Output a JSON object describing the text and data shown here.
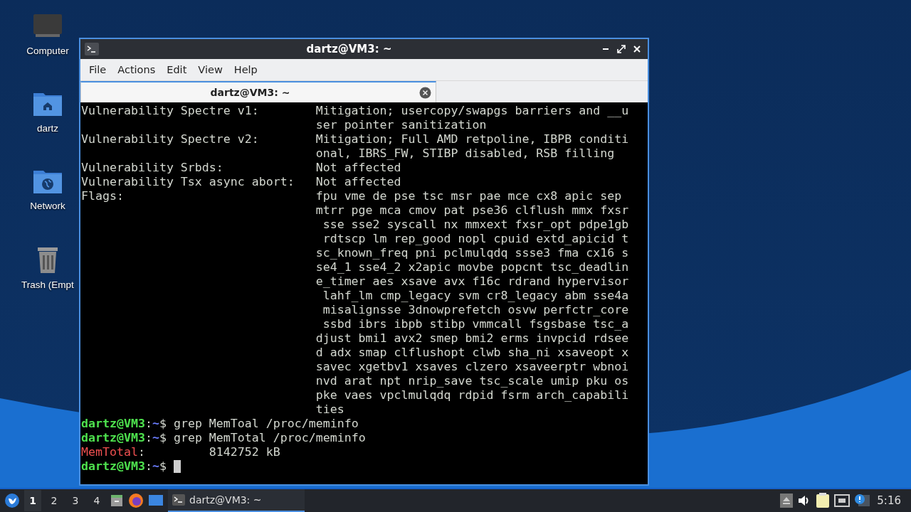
{
  "desktop_icons": [
    {
      "label": "Computer",
      "kind": "computer"
    },
    {
      "label": "dartz",
      "kind": "home"
    },
    {
      "label": "Network",
      "kind": "network"
    },
    {
      "label": "Trash (Empt",
      "kind": "trash"
    }
  ],
  "window": {
    "title": "dartz@VM3: ~",
    "menu": [
      "File",
      "Actions",
      "Edit",
      "View",
      "Help"
    ],
    "tabs": [
      {
        "label": "dartz@VM3: ~",
        "selected": true
      }
    ],
    "terminal": [
      {
        "kind": "field",
        "label": "Vulnerability Spectre v1:",
        "lines": [
          "Mitigation; usercopy/swapgs barriers and __u",
          "ser pointer sanitization"
        ]
      },
      {
        "kind": "field",
        "label": "Vulnerability Spectre v2:",
        "lines": [
          "Mitigation; Full AMD retpoline, IBPB conditi",
          "onal, IBRS_FW, STIBP disabled, RSB filling"
        ]
      },
      {
        "kind": "field",
        "label": "Vulnerability Srbds:",
        "lines": [
          "Not affected"
        ]
      },
      {
        "kind": "field",
        "label": "Vulnerability Tsx async abort:",
        "lines": [
          "Not affected"
        ]
      },
      {
        "kind": "field",
        "label": "Flags:",
        "lines": [
          "fpu vme de pse tsc msr pae mce cx8 apic sep",
          "mtrr pge mca cmov pat pse36 clflush mmx fxsr",
          " sse sse2 syscall nx mmxext fxsr_opt pdpe1gb",
          " rdtscp lm rep_good nopl cpuid extd_apicid t",
          "sc_known_freq pni pclmulqdq ssse3 fma cx16 s",
          "se4_1 sse4_2 x2apic movbe popcnt tsc_deadlin",
          "e_timer aes xsave avx f16c rdrand hypervisor",
          " lahf_lm cmp_legacy svm cr8_legacy abm sse4a",
          " misalignsse 3dnowprefetch osvw perfctr_core",
          " ssbd ibrs ibpb stibp vmmcall fsgsbase tsc_a",
          "djust bmi1 avx2 smep bmi2 erms invpcid rdsee",
          "d adx smap clflushopt clwb sha_ni xsaveopt x",
          "savec xgetbv1 xsaves clzero xsaveerptr wbnoi",
          "nvd arat npt nrip_save tsc_scale umip pku os",
          "pke vaes vpclmulqdq rdpid fsrm arch_capabili",
          "ties"
        ]
      },
      {
        "kind": "prompt",
        "user": "dartz@VM3",
        "separator": ":",
        "path": "~",
        "symbol": "$",
        "command": "grep MemToal /proc/meminfo",
        "cursor": false
      },
      {
        "kind": "prompt",
        "user": "dartz@VM3",
        "separator": ":",
        "path": "~",
        "symbol": "$",
        "command": "grep MemTotal /proc/meminfo",
        "cursor": false
      },
      {
        "kind": "keyvalue",
        "key": "MemTotal",
        "separator": ":",
        "value": "8142752 kB"
      },
      {
        "kind": "prompt",
        "user": "dartz@VM3",
        "separator": ":",
        "path": "~",
        "symbol": "$",
        "cursor": true
      }
    ]
  },
  "taskbar": {
    "workspaces": [
      {
        "label": "1",
        "selected": true
      },
      {
        "label": "2",
        "selected": false
      },
      {
        "label": "3",
        "selected": false
      },
      {
        "label": "4",
        "selected": false
      }
    ],
    "tasks": [
      {
        "label": "dartz@VM3: ~",
        "selected": true
      }
    ],
    "clock": "5:16"
  }
}
